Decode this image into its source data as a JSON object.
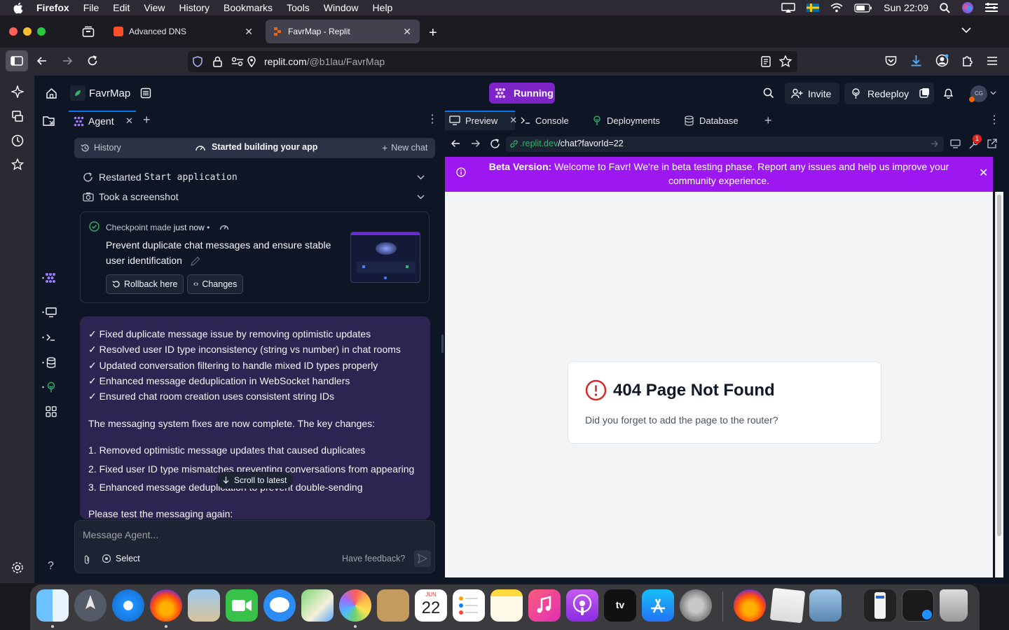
{
  "menubar": {
    "app": "Firefox",
    "items": [
      "File",
      "Edit",
      "View",
      "History",
      "Bookmarks",
      "Tools",
      "Window",
      "Help"
    ],
    "clock": "Sun 22:09"
  },
  "browser": {
    "tabs": [
      {
        "label": "Advanced DNS",
        "active": false
      },
      {
        "label": "FavrMap - Replit",
        "active": true
      }
    ],
    "url_host": "replit.com",
    "url_path": "/@b1lau/FavrMap"
  },
  "replit": {
    "repl_name": "FavrMap",
    "run_status": "Running",
    "invite_label": "Invite",
    "redeploy_label": "Redeploy",
    "avatar_initials": "CG"
  },
  "agent": {
    "tab_label": "Agent",
    "history_label": "History",
    "status_label": "Started building your app",
    "new_chat_label": "New chat",
    "log": [
      {
        "label": "Restarted ",
        "mono": "Start application"
      },
      {
        "label": "Took a screenshot",
        "mono": ""
      }
    ],
    "checkpoint": {
      "label": "Checkpoint made",
      "time": "just now",
      "title_line1": "Prevent duplicate chat messages and ensure stable",
      "title_line2": "user identification",
      "rollback_label": "Rollback here",
      "changes_label": "Changes"
    },
    "message": {
      "bullets": [
        "✓ Fixed duplicate message issue by removing optimistic updates",
        "✓ Resolved user ID type inconsistency (string vs number) in chat rooms",
        "✓ Updated conversation filtering to handle mixed ID types properly",
        "✓ Enhanced message deduplication in WebSocket handlers",
        "✓ Ensured chat room creation uses consistent string IDs"
      ],
      "summary": "The messaging system fixes are now complete. The key changes:",
      "changes": [
        "1. Removed optimistic message updates that caused duplicates",
        "2. Fixed user ID type mismatches preventing conversations from appearing",
        "3. Enhanced message deduplication to prevent double-sending"
      ],
      "closing": "Please test the messaging again:"
    },
    "scroll_latest_label": "Scroll to latest",
    "input_placeholder": "Message Agent...",
    "select_label": "Select",
    "feedback_label": "Have feedback?"
  },
  "preview": {
    "tabs": [
      "Preview",
      "Console",
      "Deployments",
      "Database"
    ],
    "url_host": ".replit.dev",
    "url_path": "/chat?favorId=22",
    "notification_count": "1",
    "beta_bold": "Beta Version:",
    "beta_line1": " Welcome to Favr! We're in beta testing phase. Report any issues and help us improve your",
    "beta_line2": "community experience.",
    "error_title": "404 Page Not Found",
    "error_body": "Did you forget to add the page to the router?"
  },
  "dock": {
    "calendar_month": "JUN",
    "calendar_day": "22"
  },
  "colors": {
    "replit_bg": "#0e1525",
    "beta_banner": "#9d18f0",
    "running_pill": "#7d24c7",
    "agent_message": "#2d2551",
    "error_red": "#dc2626"
  }
}
